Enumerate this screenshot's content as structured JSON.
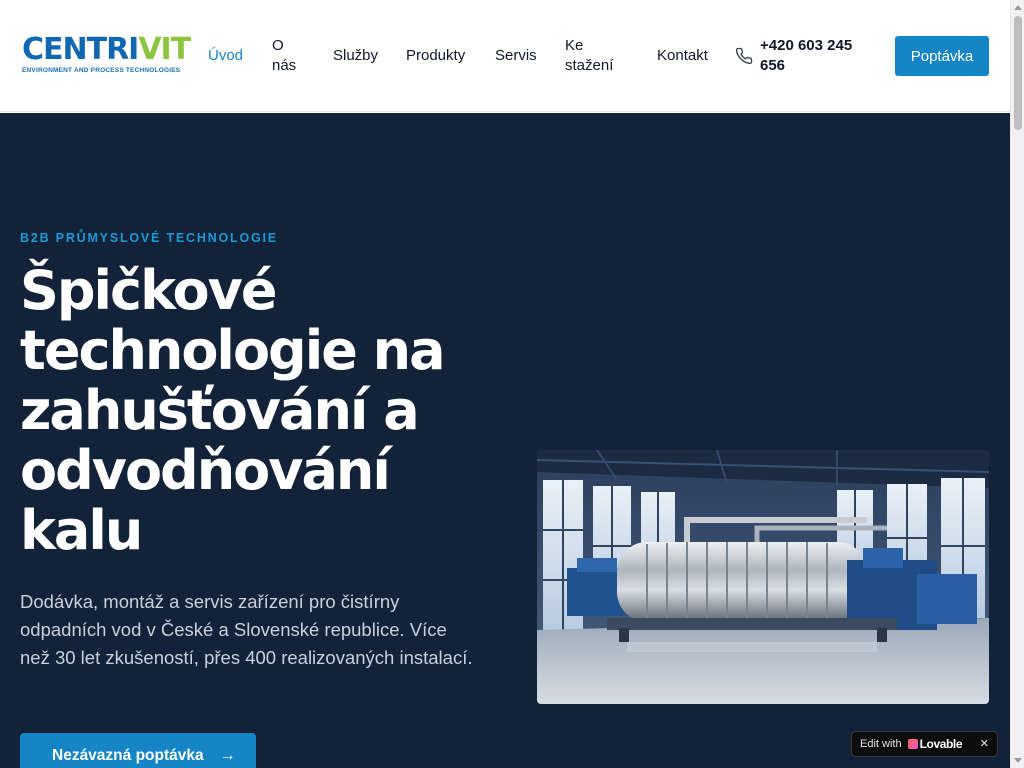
{
  "brand": {
    "logo_main": "CENTRI",
    "logo_accent": "VIT",
    "logo_sub": "ENVIRONMENT AND PROCESS TECHNOLOGIES",
    "primary_color": "#1585c6",
    "hero_bg": "#122238"
  },
  "nav": {
    "items": [
      {
        "label": "Úvod",
        "active": true
      },
      {
        "label": "O nás",
        "active": false
      },
      {
        "label": "Služby",
        "active": false
      },
      {
        "label": "Produkty",
        "active": false
      },
      {
        "label": "Servis",
        "active": false
      },
      {
        "label": "Ke stažení",
        "active": false
      },
      {
        "label": "Kontakt",
        "active": false
      }
    ],
    "phone": "+420 603 245 656",
    "phone_icon": "phone-icon",
    "cta_label": "Poptávka"
  },
  "hero": {
    "eyebrow": "B2B PRŮMYSLOVÉ TECHNOLOGIE",
    "headline": "Špičkové technologie na zahušťování a odvodňování kalu",
    "lead": "Dodávka, montáž a servis zařízení pro čistírny odpadních vod v České a Slovenské republice. Více než 30 let zkušeností, přes 400 realizovaných instalací.",
    "cta_label": "Nezávazná poptávka",
    "cta_icon": "arrow-right-icon"
  },
  "badge": {
    "edit_label": "Edit with",
    "brand_label": "Lovable",
    "close_label": "✕"
  }
}
